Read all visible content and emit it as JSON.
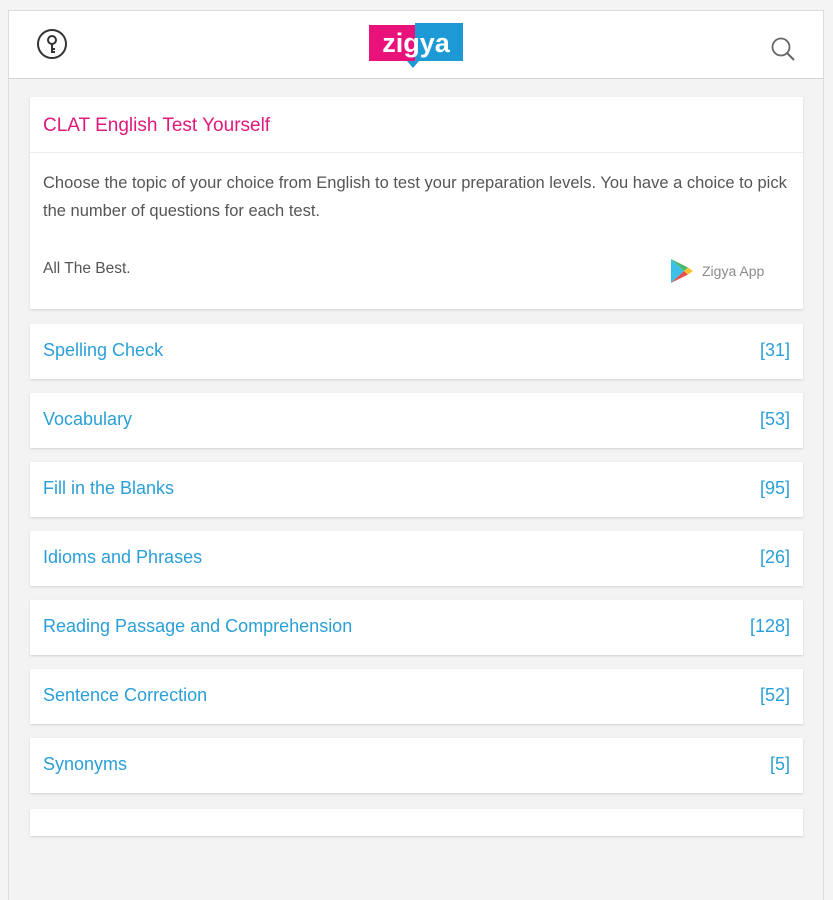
{
  "header": {
    "login_icon": "key-icon",
    "logo_text": "zigya",
    "search_icon": "search-icon"
  },
  "intro": {
    "title": "CLAT English Test Yourself",
    "description": "Choose the topic of your choice from English to test your preparation levels. You have a choice to pick the number of questions for each test.",
    "signoff": "All The Best.",
    "app_label": "Zigya App"
  },
  "topics": [
    {
      "name": "Spelling Check",
      "count": "[31]"
    },
    {
      "name": "Vocabulary",
      "count": "[53]"
    },
    {
      "name": "Fill in the Blanks",
      "count": "[95]"
    },
    {
      "name": "Idioms and Phrases",
      "count": "[26]"
    },
    {
      "name": "Reading Passage and Comprehension",
      "count": "[128]"
    },
    {
      "name": "Sentence Correction",
      "count": "[52]"
    },
    {
      "name": "Synonyms",
      "count": "[5]"
    }
  ],
  "colors": {
    "title_pink": "#e0197d",
    "link_blue": "#2a9fd8",
    "logo_pink": "#e8127a",
    "logo_blue": "#1d9ad6"
  }
}
